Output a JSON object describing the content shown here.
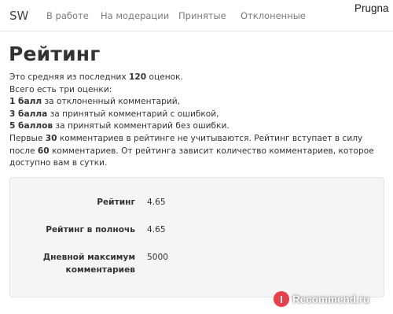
{
  "nav": {
    "brand": "SW",
    "links": [
      "В работе",
      "На модерации",
      "Принятые",
      "Отклоненные"
    ],
    "user": "Prugna"
  },
  "page": {
    "title": "Рейтинг"
  },
  "description": {
    "l1_pre": "Это средняя из последних ",
    "l1_num": "120",
    "l1_post": " оценок.",
    "l2": "Всего есть три оценки:",
    "l3_bold": "1 балл",
    "l3_rest": " за отклоненный комментарий,",
    "l4_bold": "3 балла",
    "l4_rest": " за принятый комментарий с ошибкой,",
    "l5_bold": "5 баллов",
    "l5_rest": " за принятый комментарий без ошибки.",
    "l6_pre": "Первые ",
    "l6_num1": "30",
    "l6_mid": " комментариев в рейтинге не учитываются. Рейтинг вступает в силу после ",
    "l6_num2": "60",
    "l6_post": " комментариев. От рейтинга зависит количество комментариев, которое доступно вам в сутки."
  },
  "stats": {
    "rows": [
      {
        "label": "Рейтинг",
        "value": "4.65"
      },
      {
        "label": "Рейтинг в полночь",
        "value": "4.65"
      },
      {
        "label": "Дневной максимум комментариев",
        "value": "5000"
      }
    ]
  },
  "watermark": {
    "logo_letter": "I",
    "text": "Recommend.ru"
  }
}
